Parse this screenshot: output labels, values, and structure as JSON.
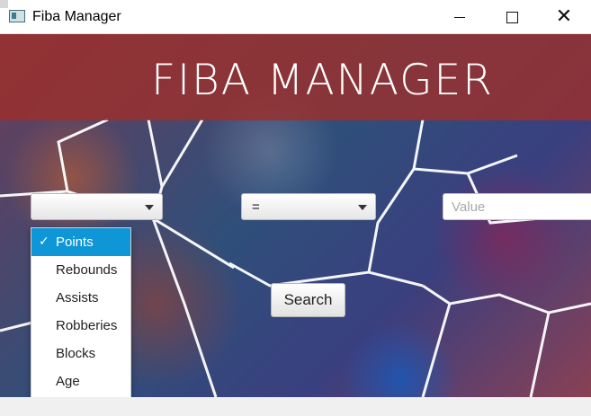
{
  "window": {
    "title": "Fiba Manager",
    "controls": {
      "minimize": "minimize",
      "maximize": "maximize",
      "close": "close"
    }
  },
  "banner": {
    "title": "FIBA MANAGER",
    "color": "#9b302c"
  },
  "filters": {
    "stat_dropdown": {
      "selected": "Points",
      "options": [
        "Points",
        "Rebounds",
        "Assists",
        "Robberies",
        "Blocks",
        "Age"
      ]
    },
    "operator_dropdown": {
      "selected": "="
    },
    "value_input": {
      "placeholder": "Value",
      "value": ""
    }
  },
  "actions": {
    "search_label": "Search"
  },
  "colors": {
    "accent": "#0e96d6",
    "banner": "#9b302c"
  }
}
